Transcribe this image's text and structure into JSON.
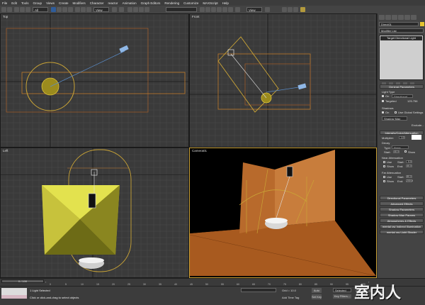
{
  "menu": [
    "File",
    "Edit",
    "Tools",
    "Group",
    "Views",
    "Create",
    "Modifiers",
    "Character",
    "reactor",
    "Animation",
    "Graph Editors",
    "Rendering",
    "Customize",
    "MAXScript",
    "Help"
  ],
  "toolbar": {
    "selection_filter": "All",
    "coord_system": "View",
    "named_selection": "",
    "coord_system_2": "View"
  },
  "viewports": {
    "top": "Top",
    "front": "Front",
    "left": "Left",
    "camera": "Camera01"
  },
  "command_panel": {
    "object_name": "Direct01",
    "modifier_list": "Modifier List",
    "stack_item": "Target Directional Light",
    "general_parameters": "General Parameters",
    "light_type_label": "Light Type",
    "on_label": "On",
    "light_type_value": "Directional",
    "targeted_label": "Targeted",
    "targeted_value": "125.756",
    "shadows_label": "Shadows",
    "shadows_on_label": "On",
    "use_global_label": "Use Global Settings",
    "shadow_type": "Shadow Map",
    "exclude_button": "Exclude...",
    "intensity_rollout": "Intensity/Color/Attenuation",
    "multiplier_label": "Multiplier:",
    "multiplier_value": "1.0",
    "decay_label": "Decay",
    "decay_type_label": "Type:",
    "decay_type_value": "None",
    "start_label": "Start:",
    "start_value": "40.0",
    "show_label": "Show",
    "near_atten_label": "Near Attenuation",
    "use_label": "Use",
    "near_start_label": "Start:",
    "near_start_value": "0.0",
    "near_show_label": "Show",
    "near_end_label": "End:",
    "near_end_value": "40.0",
    "far_atten_label": "Far Attenuation",
    "far_use_label": "Use",
    "far_start_label": "Start:",
    "far_start_value": "80.0",
    "far_show_label": "Show",
    "far_end_label": "End:",
    "far_end_value": "200.0",
    "rollouts": [
      "Directional Parameters",
      "Advanced Effects",
      "Shadow Parameters",
      "Shadow Map Params",
      "Atmospheres & Effects",
      "mental ray Indirect Illumination",
      "mental ray Light Shader"
    ]
  },
  "timeline": {
    "frame_display": "0 / 100",
    "ticks": [
      "0",
      "5",
      "10",
      "15",
      "20",
      "25",
      "30",
      "35",
      "40",
      "45",
      "50",
      "55",
      "60",
      "65",
      "70",
      "75",
      "80",
      "85",
      "90",
      "95",
      "100"
    ]
  },
  "status": {
    "selection_count": "1 Light Selected",
    "prompt": "Click or click-and-drag to select objects",
    "grid": "Grid = 10.0",
    "auto_key": "Auto Key",
    "selected": "Selected",
    "set_key": "Set Key",
    "key_filters": "Key Filters...",
    "add_time_tag": "Add Time Tag",
    "frame": "0"
  },
  "watermark": "室内人"
}
